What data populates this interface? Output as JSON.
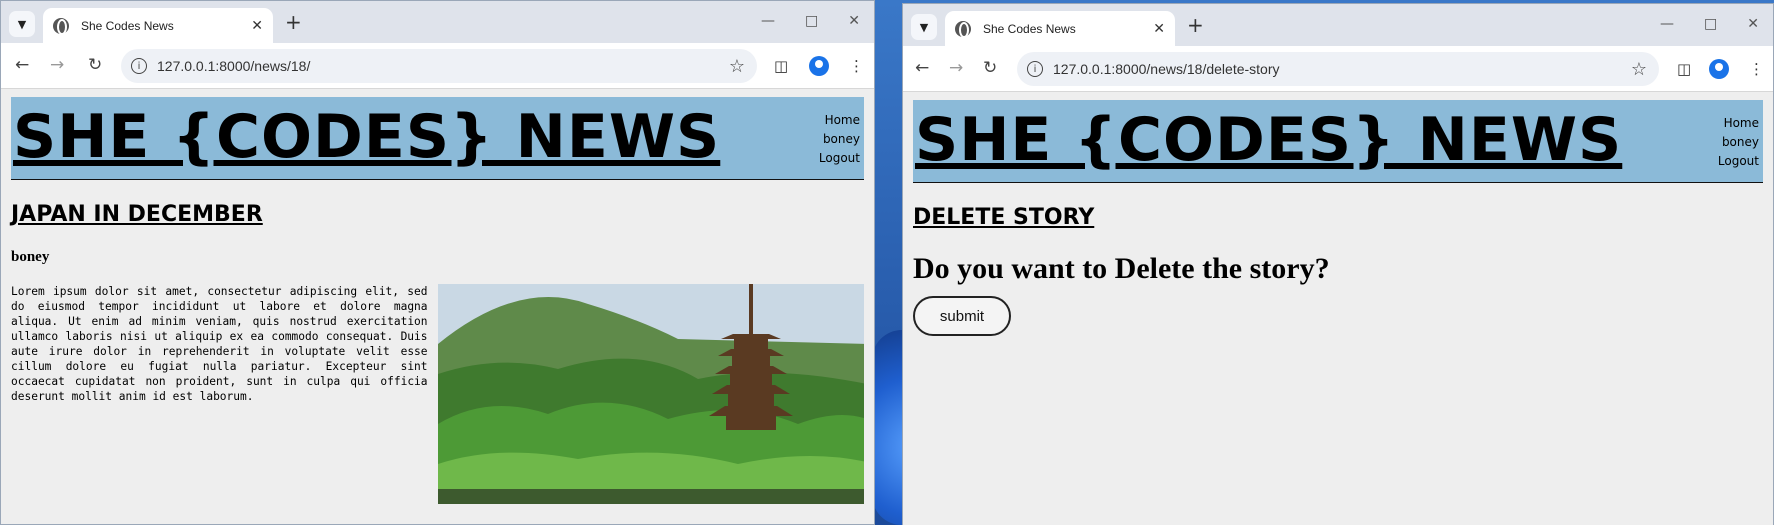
{
  "left_window": {
    "tab_title": "She Codes News",
    "url": "127.0.0.1:8000/news/18/",
    "site_title": "SHE {CODES} NEWS",
    "nav": [
      "Home",
      "boney",
      "Logout"
    ],
    "story_title": "JAPAN IN DECEMBER",
    "author": "boney",
    "body": "Lorem ipsum dolor sit amet, consectetur adipiscing elit, sed do eiusmod tempor incididunt ut labore et dolore magna aliqua. Ut enim ad minim veniam, quis nostrud exercitation ullamco laboris nisi ut aliquip ex ea commodo consequat. Duis aute irure dolor in reprehenderit in voluptate velit esse cillum dolore eu fugiat nulla pariatur. Excepteur sint occaecat cupidatat non proident, sunt in culpa qui officia deserunt mollit anim id est laborum.",
    "image_subject": "japanese pagoda in forest"
  },
  "right_window": {
    "tab_title": "She Codes News",
    "url": "127.0.0.1:8000/news/18/delete-story",
    "site_title": "SHE {CODES} NEWS",
    "nav": [
      "Home",
      "boney",
      "Logout"
    ],
    "heading": "DELETE STORY",
    "question": "Do you want to Delete the story?",
    "submit_label": "submit"
  },
  "icons": {
    "tab_menu": "chevron-down-icon",
    "favicon": "globe-icon",
    "close": "close-icon",
    "new_tab": "plus-icon",
    "back": "back-arrow-icon",
    "forward": "forward-arrow-icon",
    "reload": "reload-icon",
    "site_info": "info-icon",
    "bookmark": "star-icon",
    "side_panel": "side-panel-icon",
    "profile": "profile-icon",
    "menu": "kebab-menu-icon"
  },
  "colors": {
    "header_bg": "#8bbad8",
    "page_bg": "#eeeeee",
    "tabbar_bg": "#dfe3eb"
  }
}
